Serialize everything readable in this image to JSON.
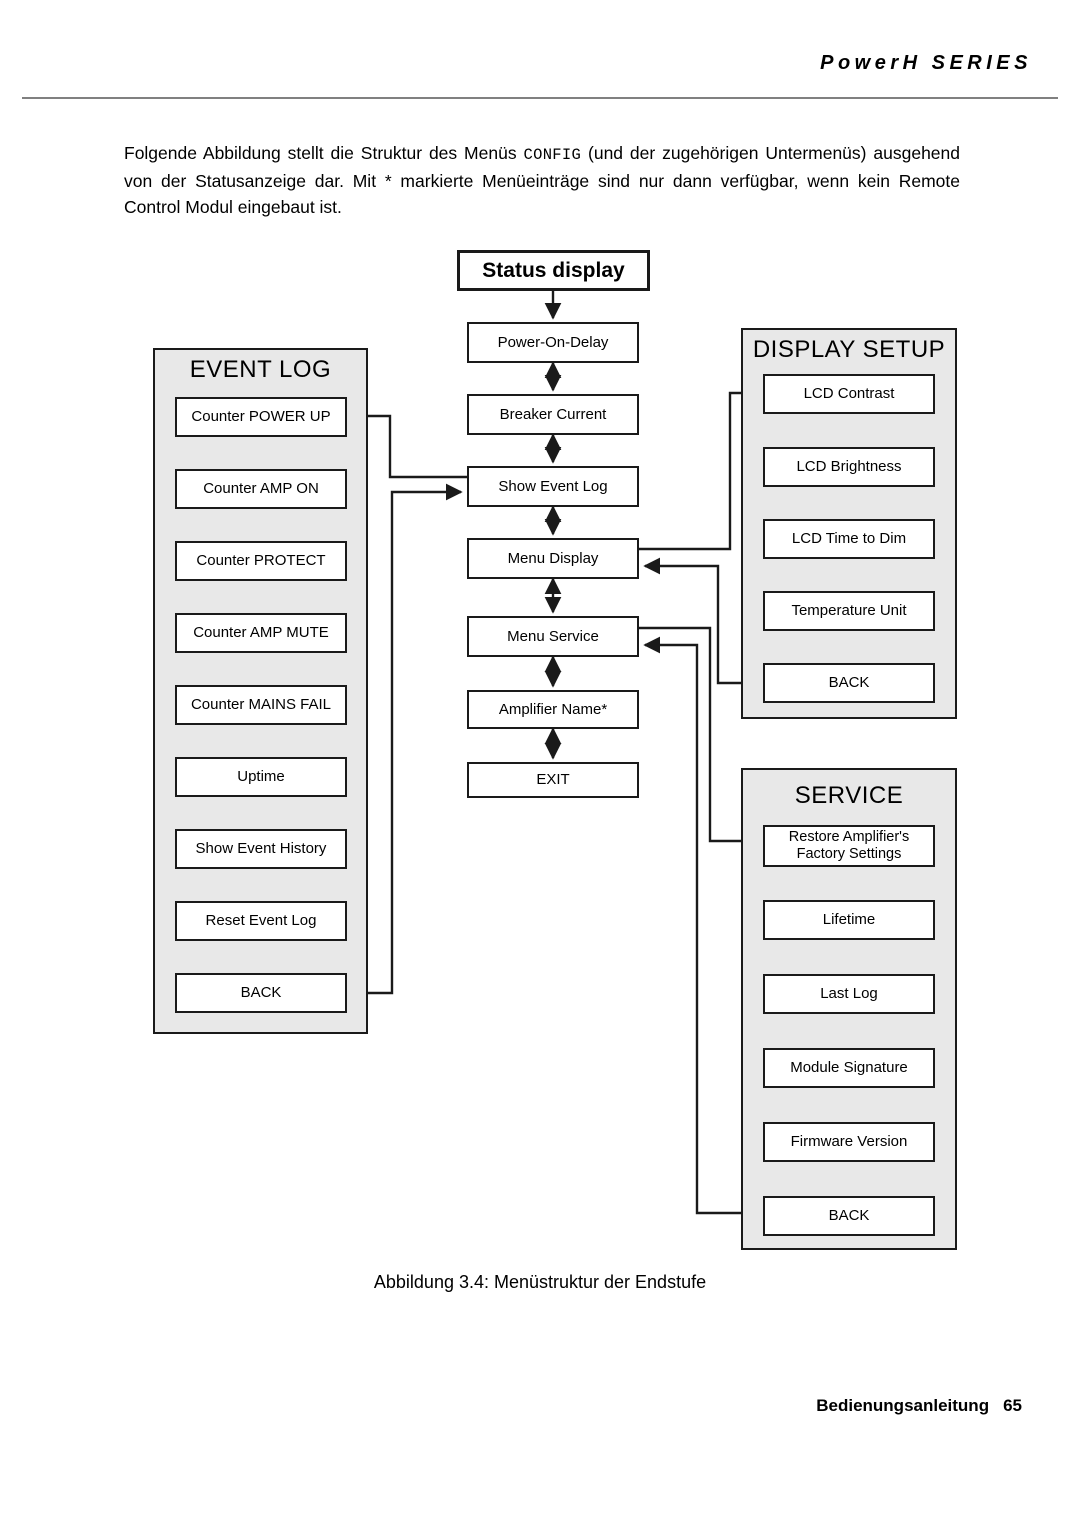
{
  "header": {
    "series_title": "PowerH SERIES"
  },
  "intro": {
    "text_before_code": "Folgende Abbildung stellt die Struktur des Menüs ",
    "code": "CONFIG",
    "text_after_code": " (und der zugehörigen Untermenüs) ausgehend von der Statusanzeige dar. Mit * markierte Menüeinträge sind nur dann verfügbar, wenn kein Remote Control Modul eingebaut ist."
  },
  "diagram": {
    "root": {
      "label": "Status display"
    },
    "main_column": {
      "nodes": [
        {
          "label": "Power-On-Delay"
        },
        {
          "label": "Breaker Current"
        },
        {
          "label": "Show Event Log"
        },
        {
          "label": "Menu Display"
        },
        {
          "label": "Menu Service"
        },
        {
          "label": "Amplifier Name*"
        },
        {
          "label": "EXIT"
        }
      ]
    },
    "event_log_group": {
      "title": "EVENT LOG",
      "nodes": [
        {
          "label": "Counter POWER UP"
        },
        {
          "label": "Counter AMP ON"
        },
        {
          "label": "Counter PROTECT"
        },
        {
          "label": "Counter AMP MUTE"
        },
        {
          "label": "Counter MAINS FAIL"
        },
        {
          "label": "Uptime"
        },
        {
          "label": "Show Event History"
        },
        {
          "label": "Reset Event Log"
        },
        {
          "label": "BACK"
        }
      ]
    },
    "display_setup_group": {
      "title": "DISPLAY SETUP",
      "nodes": [
        {
          "label": "LCD Contrast"
        },
        {
          "label": "LCD Brightness"
        },
        {
          "label": "LCD Time to Dim"
        },
        {
          "label": "Temperature Unit"
        },
        {
          "label": "BACK"
        }
      ]
    },
    "service_group": {
      "title": "SERVICE",
      "nodes": [
        {
          "label_line1": "Restore Amplifier's",
          "label_line2": "Factory Settings"
        },
        {
          "label": "Lifetime"
        },
        {
          "label": "Last Log"
        },
        {
          "label": "Module Signature"
        },
        {
          "label": "Firmware Version"
        },
        {
          "label": "BACK"
        }
      ]
    }
  },
  "caption": {
    "text": "Abbildung 3.4: Menüstruktur der Endstufe"
  },
  "footer": {
    "label": "Bedienungsanleitung",
    "page_number": "65"
  },
  "colors": {
    "group_background": "#e8e8e8",
    "line": "#1a1a1a",
    "rule": "#808080"
  }
}
